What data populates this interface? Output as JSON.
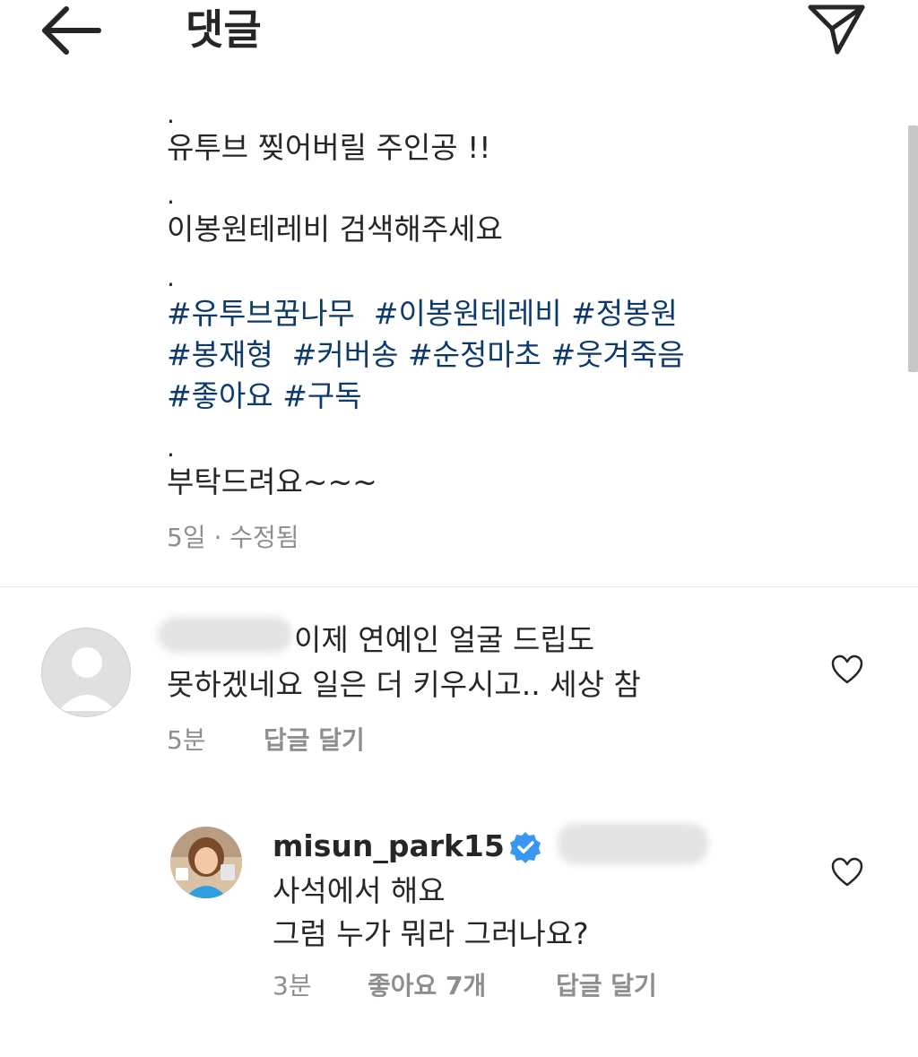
{
  "header": {
    "title": "댓글",
    "back_icon": "arrow-left-icon",
    "send_icon": "paper-plane-icon"
  },
  "caption": {
    "dot1": ".",
    "line1": "유투브  찢어버릴  주인공 !!",
    "dot2": ".",
    "line2": "이봉원테레비  검색해주세요",
    "dot3": ".",
    "hashtags_line1": [
      "#유투브꿈나무",
      "#이봉원테레비",
      "#정봉원"
    ],
    "hashtags_line2": [
      "#봉재형",
      "#커버송",
      "#순정마초",
      "#웃겨죽음"
    ],
    "hashtags_line3": [
      "#좋아요",
      "#구독"
    ],
    "dot4": ".",
    "line3": "부탁드려요~~~",
    "meta": "5일 · 수정됨"
  },
  "comments": [
    {
      "text_line1": "이제 연예인 얼굴 드립도",
      "text_line2": "못하겠네요  일은 더 키우시고.. 세상 참",
      "time": "5분",
      "reply_label": "답글 달기"
    },
    {
      "username": "misun_park15",
      "text_line1": "사석에서 해요",
      "text_line2": "그럼 누가 뭐라 그러나요?",
      "time": "3분",
      "likes": "좋아요 7개",
      "reply_label": "답글 달기"
    }
  ],
  "colors": {
    "hashtag": "#0e3a6b",
    "meta": "#8e8e8e",
    "verified": "#3897f0"
  }
}
